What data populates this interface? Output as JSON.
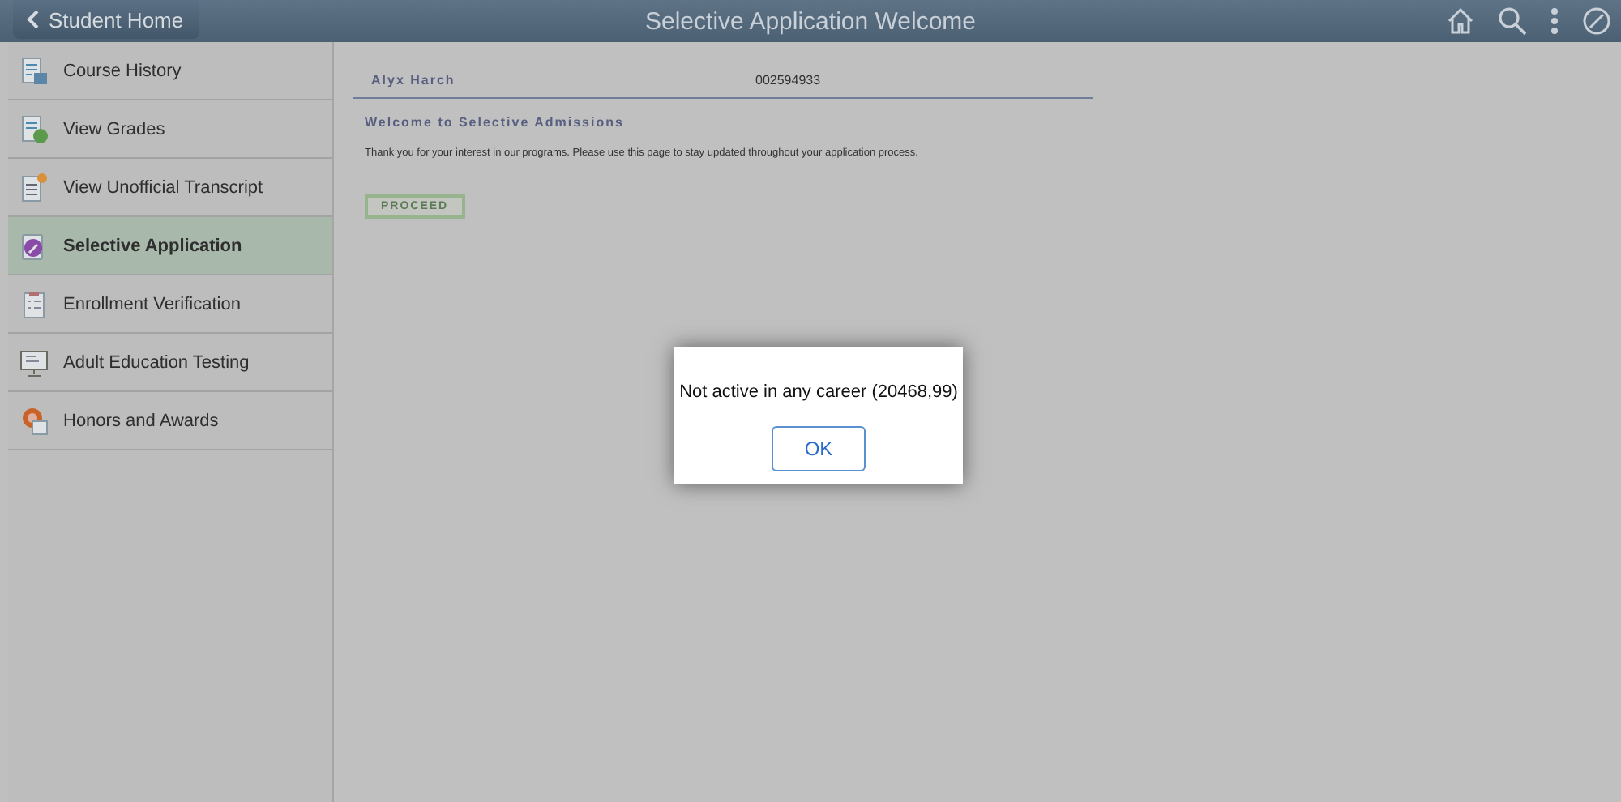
{
  "header": {
    "back_button": "Student Home",
    "title": "Selective Application Welcome"
  },
  "sidebar": {
    "items": [
      {
        "label": "Course History",
        "selected": false
      },
      {
        "label": "View Grades",
        "selected": false
      },
      {
        "label": "View Unofficial Transcript",
        "selected": false
      },
      {
        "label": "Selective Application",
        "selected": true
      },
      {
        "label": "Enrollment Verification",
        "selected": false
      },
      {
        "label": "Adult Education Testing",
        "selected": false
      },
      {
        "label": "Honors and Awards",
        "selected": false
      }
    ]
  },
  "content": {
    "student_name": "Alyx Harch",
    "student_id": "002594933",
    "heading": "Welcome to Selective Admissions",
    "message": "Thank you for your interest in our programs. Please use this page to stay updated throughout your application process.",
    "proceed_button": "PROCEED"
  },
  "dialog": {
    "message": "Not active in any career (20468,99)",
    "ok_button": "OK"
  }
}
